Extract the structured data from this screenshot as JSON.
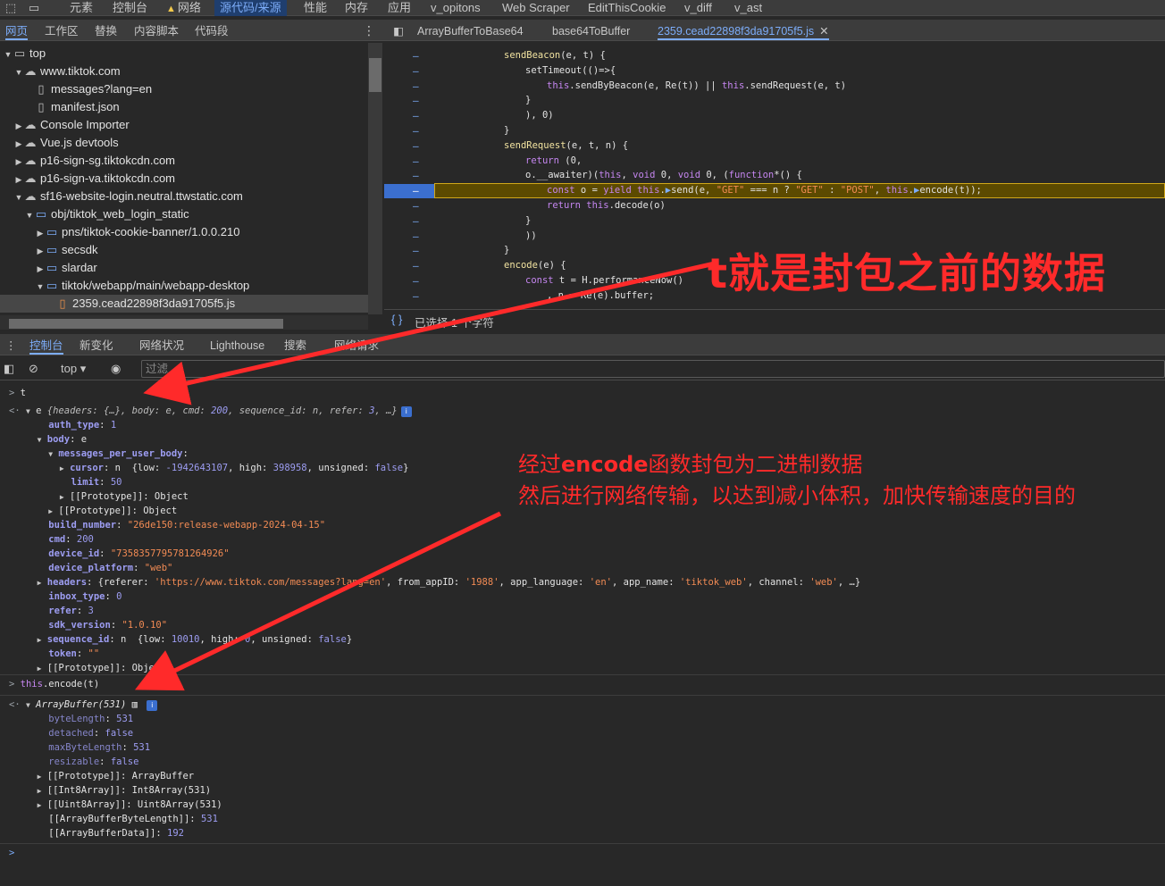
{
  "top_tabs": [
    "元素",
    "控制台",
    "网络",
    "源代码/来源",
    "性能",
    "内存",
    "应用",
    "v_opitons",
    "Web Scraper",
    "EditThisCookie",
    "v_diff",
    "v_ast"
  ],
  "sources_subtabs": [
    "网页",
    "工作区",
    "替换",
    "内容脚本",
    "代码段"
  ],
  "file_tree": [
    {
      "label": "top",
      "depth": 0,
      "icon": "frame",
      "arrow": "open"
    },
    {
      "label": "www.tiktok.com",
      "depth": 1,
      "icon": "cloud",
      "arrow": "open"
    },
    {
      "label": "messages?lang=en",
      "depth": 2,
      "icon": "file-dot",
      "arrow": ""
    },
    {
      "label": "manifest.json",
      "depth": 2,
      "icon": "file",
      "arrow": ""
    },
    {
      "label": "Console Importer",
      "depth": 1,
      "icon": "cloud",
      "arrow": "closed"
    },
    {
      "label": "Vue.js devtools",
      "depth": 1,
      "icon": "cloud",
      "arrow": "closed"
    },
    {
      "label": "p16-sign-sg.tiktokcdn.com",
      "depth": 1,
      "icon": "cloud",
      "arrow": "closed"
    },
    {
      "label": "p16-sign-va.tiktokcdn.com",
      "depth": 1,
      "icon": "cloud",
      "arrow": "closed"
    },
    {
      "label": "sf16-website-login.neutral.ttwstatic.com",
      "depth": 1,
      "icon": "cloud",
      "arrow": "open"
    },
    {
      "label": "obj/tiktok_web_login_static",
      "depth": 2,
      "icon": "folder",
      "arrow": "open"
    },
    {
      "label": "pns/tiktok-cookie-banner/1.0.0.210",
      "depth": 3,
      "icon": "folder",
      "arrow": "closed"
    },
    {
      "label": "secsdk",
      "depth": 3,
      "icon": "folder",
      "arrow": "closed"
    },
    {
      "label": "slardar",
      "depth": 3,
      "icon": "folder",
      "arrow": "closed"
    },
    {
      "label": "tiktok/webapp/main/webapp-desktop",
      "depth": 3,
      "icon": "folder",
      "arrow": "open"
    },
    {
      "label": "2359.cead22898f3da91705f5.js",
      "depth": 4,
      "icon": "jsfile",
      "arrow": "",
      "selected": true
    }
  ],
  "editor_tabs": [
    "ArrayBufferToBase64",
    "base64ToBuffer",
    "2359.cead22898f3da91705f5.js"
  ],
  "code_lines": [
    {
      "indent": 6,
      "html": "<span class=\"fn\">sendBeacon</span>(e, t) {"
    },
    {
      "indent": 8,
      "html": "setTimeout(()=>{"
    },
    {
      "indent": 10,
      "html": "<span class=\"kw\">this</span>.sendByBeacon(e, Re(t)) || <span class=\"kw\">this</span>.sendRequest(e, t)"
    },
    {
      "indent": 8,
      "html": "}"
    },
    {
      "indent": 8,
      "html": "), 0)"
    },
    {
      "indent": 6,
      "html": "}"
    },
    {
      "indent": 6,
      "html": "<span class=\"fn\">sendRequest</span>(e, t, n) {"
    },
    {
      "indent": 8,
      "html": "<span class=\"kw\">return</span> (0,"
    },
    {
      "indent": 8,
      "html": "o.__awaiter)(<span class=\"kw\">this</span>, <span class=\"kw\">void</span> 0, <span class=\"kw\">void</span> 0, (<span class=\"kw\">function</span>*() {"
    },
    {
      "indent": 10,
      "html": "<span class=\"kw\">const</span> o = <span class=\"kw\">yield</span> <span class=\"kw\">this</span>.<span class=\"mark\">▶</span>send(e, <span class=\"str\">\"GET\"</span> === n ? <span class=\"str\">\"GET\"</span> : <span class=\"str\">\"POST\"</span>, <span class=\"kw\">this</span>.<span class=\"mark\">▶</span>encode(t));",
      "highlight": true
    },
    {
      "indent": 10,
      "html": "<span class=\"kw\">return</span> <span class=\"kw\">this</span>.decode(o)"
    },
    {
      "indent": 8,
      "html": "}"
    },
    {
      "indent": 8,
      "html": "))"
    },
    {
      "indent": 6,
      "html": "}"
    },
    {
      "indent": 6,
      "html": "<span class=\"fn\">encode</span>(e) {"
    },
    {
      "indent": 8,
      "html": "<span class=\"kw\">const</span> t = H.performanceNow()"
    },
    {
      "indent": 10,
      "html": ", n = Re(e).buffer;"
    }
  ],
  "status_text": "已选择 1 个字符",
  "drawer_tabs": [
    "控制台",
    "新变化",
    "网络状况",
    "Lighthouse",
    "搜索",
    "网络请求"
  ],
  "console_toolbar": {
    "context": "top",
    "filter_placeholder": "过滤"
  },
  "console_lines": [
    {
      "html": "<span class=\"prompt\">&gt;</span> t",
      "sep": true
    },
    {
      "html": "<span class=\"prompt\">&lt;·</span> <span class=\"tri\">▼</span> e <span class=\"italic\" style=\"color:#bdbdbd\">{headers: {…}, body: e, cmd: <span class=\"val-num\">200</span>, sequence_id: n, refer: <span class=\"val-num\">3</span>, …}</span><span class=\"info-badge\">i</span>"
    },
    {
      "html": "       <span class=\"key\">auth_type</span>: <span class=\"val-num\">1</span>"
    },
    {
      "html": "     <span class=\"tri\">▼</span> <span class=\"key\">body</span>: e"
    },
    {
      "html": "       <span class=\"tri\">▼</span> <span class=\"key\">messages_per_user_body</span>:"
    },
    {
      "html": "         <span class=\"tri\">▶</span> <span class=\"key\">cursor</span>: n  {low: <span class=\"val-num\">-1942643107</span>, high: <span class=\"val-num\">398958</span>, unsigned: <span class=\"val-bool\">false</span>}"
    },
    {
      "html": "           <span class=\"key\">limit</span>: <span class=\"val-num\">50</span>"
    },
    {
      "html": "         <span class=\"tri\">▶</span> [[Prototype]]: Object"
    },
    {
      "html": "       <span class=\"tri\">▶</span> [[Prototype]]: Object"
    },
    {
      "html": "       <span class=\"key\">build_number</span>: <span class=\"val-str\">\"26de150:release-webapp-2024-04-15\"</span>"
    },
    {
      "html": "       <span class=\"key\">cmd</span>: <span class=\"val-num\">200</span>"
    },
    {
      "html": "       <span class=\"key\">device_id</span>: <span class=\"val-str\">\"7358357795781264926\"</span>"
    },
    {
      "html": "       <span class=\"key\">device_platform</span>: <span class=\"val-str\">\"web\"</span>"
    },
    {
      "html": "     <span class=\"tri\">▶</span> <span class=\"key\">headers</span>: {referer: <span class=\"val-str\">'https://www.tiktok.com/messages?lang=en'</span>, from_appID: <span class=\"val-str\">'1988'</span>, app_language: <span class=\"val-str\">'en'</span>, app_name: <span class=\"val-str\">'tiktok_web'</span>, channel: <span class=\"val-str\">'web'</span>, …}"
    },
    {
      "html": "       <span class=\"key\">inbox_type</span>: <span class=\"val-num\">0</span>"
    },
    {
      "html": "       <span class=\"key\">refer</span>: <span class=\"val-num\">3</span>"
    },
    {
      "html": "       <span class=\"key\">sdk_version</span>: <span class=\"val-str\">\"1.0.10\"</span>"
    },
    {
      "html": "     <span class=\"tri\">▶</span> <span class=\"key\">sequence_id</span>: n  {low: <span class=\"val-num\">10010</span>, high: <span class=\"val-num\">0</span>, unsigned: <span class=\"val-bool\">false</span>}"
    },
    {
      "html": "       <span class=\"key\">token</span>: <span class=\"val-str\">\"\"</span>"
    },
    {
      "html": "     <span class=\"tri\">▶</span> [[Prototype]]: Object"
    },
    {
      "html": "<span class=\"prompt\">&gt;</span> <span class=\"kw\">this</span>.encode(t)",
      "sep": true
    },
    {
      "html": "<span class=\"prompt\">&lt;·</span> <span class=\"tri\">▼</span> <span class=\"italic\">ArrayBuffer(531)</span> ▥ <span class=\"info-badge\">i</span>",
      "sep": true
    },
    {
      "html": "       <span class=\"key-dim\">byteLength</span>: <span class=\"val-num\">531</span>"
    },
    {
      "html": "       <span class=\"key-dim\">detached</span>: <span class=\"val-bool\">false</span>"
    },
    {
      "html": "       <span class=\"key-dim\">maxByteLength</span>: <span class=\"val-num\">531</span>"
    },
    {
      "html": "       <span class=\"key-dim\">resizable</span>: <span class=\"val-bool\">false</span>"
    },
    {
      "html": "     <span class=\"tri\">▶</span> [[Prototype]]: ArrayBuffer"
    },
    {
      "html": "     <span class=\"tri\">▶</span> [[Int8Array]]: Int8Array(531)"
    },
    {
      "html": "     <span class=\"tri\">▶</span> [[Uint8Array]]: Uint8Array(531)"
    },
    {
      "html": "       [[ArrayBufferByteLength]]: <span class=\"val-num\">531</span>"
    },
    {
      "html": "       [[ArrayBufferData]]: <span class=\"val-num\">192</span>"
    },
    {
      "html": "<span class=\"prompt\" style=\"color:#7cacf8\">&gt;</span>",
      "sep": true
    }
  ],
  "annotations": {
    "big": "t就是封包之前的数据",
    "line1_prefix": "经过",
    "line1_bold": "encode",
    "line1_suffix": "函数封包为二进制数据",
    "line2": "然后进行网络传输，以达到减小体积，加快传输速度的目的"
  },
  "colors": {
    "accent": "#7cacf8",
    "annotation": "#ff2a2a",
    "highlight": "#5c4a00"
  }
}
